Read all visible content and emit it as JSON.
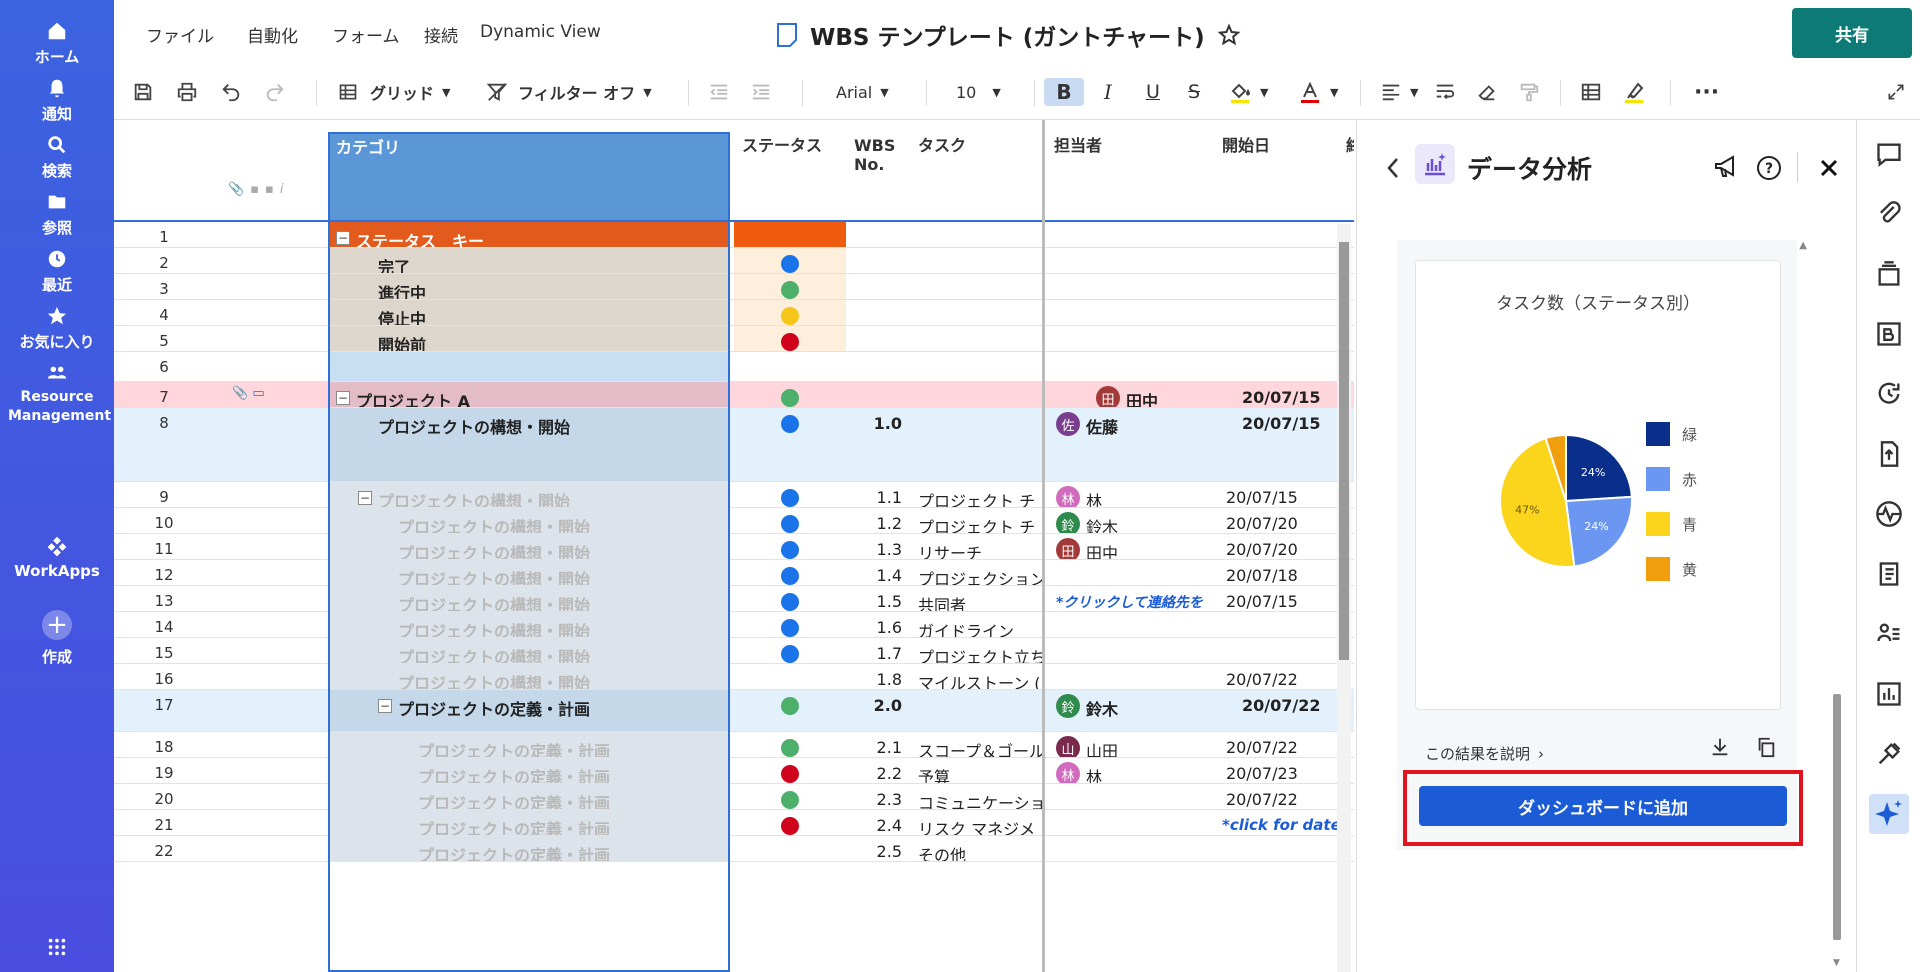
{
  "leftnav": {
    "items": [
      {
        "label": "ホーム",
        "icon": "home-icon"
      },
      {
        "label": "通知",
        "icon": "bell-icon"
      },
      {
        "label": "検索",
        "icon": "search-icon"
      },
      {
        "label": "参照",
        "icon": "folder-icon"
      },
      {
        "label": "最近",
        "icon": "clock-icon"
      },
      {
        "label": "お気に入り",
        "icon": "star-icon"
      },
      {
        "label": "Resource Management",
        "icon": "people-icon"
      },
      {
        "label": "WorkApps",
        "icon": "workapps-icon"
      },
      {
        "label": "作成",
        "icon": "plus-icon"
      }
    ]
  },
  "menu": {
    "file": "ファイル",
    "automation": "自動化",
    "form": "フォーム",
    "connect": "接続",
    "dynamic": "Dynamic View"
  },
  "doc_title": "WBS テンプレート (ガントチャート)",
  "share": "共有",
  "toolbar": {
    "grid": "グリッド",
    "filter": "フィルター オフ",
    "font": "Arial",
    "size": "10",
    "bold": "B",
    "italic": "I",
    "underline": "U",
    "strike": "S"
  },
  "columns": {
    "category": "カテゴリ",
    "status": "ステータス",
    "wbs": "WBS No.",
    "task": "タスク",
    "assignee": "担当者",
    "start": "開始日",
    "partial": "終"
  },
  "rows": [
    {
      "n": "1",
      "cat": "ステータス　キー",
      "status": "",
      "wbs": "",
      "task": "",
      "who": "",
      "start": ""
    },
    {
      "n": "2",
      "cat": "完了",
      "status": "#1a73e8",
      "wbs": "",
      "task": "",
      "who": "",
      "start": ""
    },
    {
      "n": "3",
      "cat": "進行中",
      "status": "#4caf6a",
      "wbs": "",
      "task": "",
      "who": "",
      "start": ""
    },
    {
      "n": "4",
      "cat": "停止中",
      "status": "#f5c518",
      "wbs": "",
      "task": "",
      "who": "",
      "start": ""
    },
    {
      "n": "5",
      "cat": "開始前",
      "status": "#d0021b",
      "wbs": "",
      "task": "",
      "who": "",
      "start": ""
    },
    {
      "n": "6",
      "cat": "",
      "status": "",
      "wbs": "",
      "task": "",
      "who": "",
      "start": ""
    },
    {
      "n": "7",
      "cat": "プロジェクト A",
      "status": "#4caf6a",
      "wbs": "",
      "task": "",
      "who": "田中",
      "avatar": "田",
      "start": "20/07/15"
    },
    {
      "n": "8",
      "cat": "プロジェクトの構想・開始",
      "status": "#1a73e8",
      "wbs": "1.0",
      "task": "",
      "who": "佐藤",
      "avatar": "佐",
      "start": "20/07/15"
    },
    {
      "n": "9",
      "cat": "プロジェクトの構想・開始",
      "status": "#1a73e8",
      "wbs": "1.1",
      "task": "プロジェクト チ",
      "who": "林",
      "avatar": "林",
      "start": "20/07/15"
    },
    {
      "n": "10",
      "cat": "プロジェクトの構想・開始",
      "status": "#1a73e8",
      "wbs": "1.2",
      "task": "プロジェクト チ",
      "who": "鈴木",
      "avatar": "鈴",
      "start": "20/07/20"
    },
    {
      "n": "11",
      "cat": "プロジェクトの構想・開始",
      "status": "#1a73e8",
      "wbs": "1.3",
      "task": "リサーチ",
      "who": "田中",
      "avatar": "田",
      "start": "20/07/20"
    },
    {
      "n": "12",
      "cat": "プロジェクトの構想・開始",
      "status": "#1a73e8",
      "wbs": "1.4",
      "task": "プロジェクション",
      "who": "",
      "start": "20/07/18"
    },
    {
      "n": "13",
      "cat": "プロジェクトの構想・開始",
      "status": "#1a73e8",
      "wbs": "1.5",
      "task": "共同者",
      "who": "*クリックして連絡先を",
      "start": "20/07/15"
    },
    {
      "n": "14",
      "cat": "プロジェクトの構想・開始",
      "status": "#1a73e8",
      "wbs": "1.6",
      "task": "ガイドライン",
      "who": "",
      "start": ""
    },
    {
      "n": "15",
      "cat": "プロジェクトの構想・開始",
      "status": "#1a73e8",
      "wbs": "1.7",
      "task": "プロジェクト立ち",
      "who": "",
      "start": ""
    },
    {
      "n": "16",
      "cat": "プロジェクトの構想・開始",
      "status": "",
      "wbs": "1.8",
      "task": "マイルストーン (",
      "who": "",
      "start": "20/07/22"
    },
    {
      "n": "17",
      "cat": "プロジェクトの定義・計画",
      "status": "#4caf6a",
      "wbs": "2.0",
      "task": "",
      "who": "鈴木",
      "avatar": "鈴",
      "start": "20/07/22"
    },
    {
      "n": "18",
      "cat": "プロジェクトの定義・計画",
      "status": "#4caf6a",
      "wbs": "2.1",
      "task": "スコープ＆ゴール",
      "who": "山田",
      "avatar": "山",
      "start": "20/07/22"
    },
    {
      "n": "19",
      "cat": "プロジェクトの定義・計画",
      "status": "#d0021b",
      "wbs": "2.2",
      "task": "予算",
      "who": "林",
      "avatar": "林",
      "start": "20/07/23"
    },
    {
      "n": "20",
      "cat": "プロジェクトの定義・計画",
      "status": "#4caf6a",
      "wbs": "2.3",
      "task": "コミュニケーショ",
      "who": "",
      "start": "20/07/22"
    },
    {
      "n": "21",
      "cat": "プロジェクトの定義・計画",
      "status": "#d0021b",
      "wbs": "2.4",
      "task": "リスク マネジメ",
      "who": "",
      "start": "*click for date"
    },
    {
      "n": "22",
      "cat": "プロジェクトの定義・計画",
      "status": "",
      "wbs": "2.5",
      "task": "その他",
      "who": "",
      "start": ""
    }
  ],
  "panel": {
    "title": "データ分析",
    "card_title": "タスク数（ステータス別）",
    "explain": "この結果を説明",
    "add_button": "ダッシュボードに追加"
  },
  "chart_data": {
    "type": "pie",
    "title": "タスク数（ステータス別）",
    "categories": [
      "緑",
      "赤",
      "青",
      "黄"
    ],
    "values": [
      24,
      24,
      47,
      5
    ],
    "colors": [
      "#0a2f8a",
      "#6b97f2",
      "#fad51c",
      "#f09e0b"
    ],
    "data_labels": [
      "24%",
      "24%",
      "47%",
      ""
    ],
    "legend_position": "right"
  }
}
